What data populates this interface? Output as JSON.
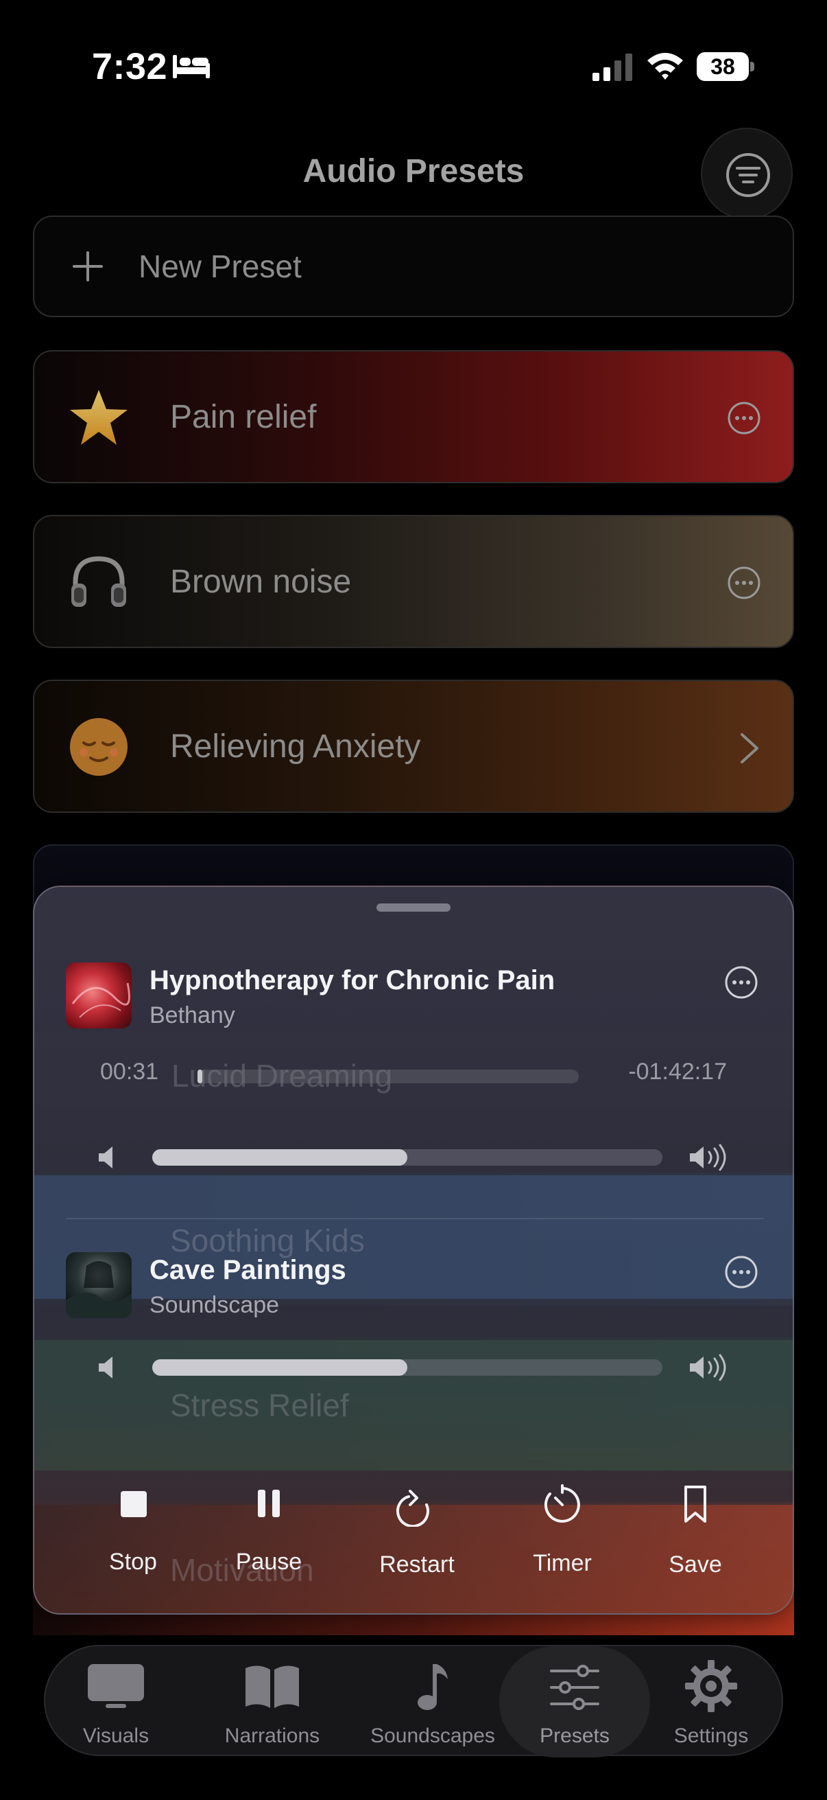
{
  "status_bar": {
    "time": "7:32",
    "battery": "38"
  },
  "header": {
    "title": "Audio Presets"
  },
  "new_preset": {
    "label": "New Preset"
  },
  "presets": [
    {
      "label": "Pain relief",
      "icon": "star-icon",
      "action": "more"
    },
    {
      "label": "Brown noise",
      "icon": "headphones-icon",
      "action": "more"
    },
    {
      "label": "Relieving Anxiety",
      "icon": "relieved-face-icon",
      "action": "chevron"
    }
  ],
  "background_presets": [
    "Lucid Dreaming",
    "Soothing Kids",
    "Stress Relief",
    "Motivation"
  ],
  "player": {
    "narration": {
      "title": "Hypnotherapy for Chronic Pain",
      "subtitle": "Bethany",
      "elapsed": "00:31",
      "remaining": "-01:42:17",
      "progress": 0.01,
      "volume": 0.5
    },
    "soundscape": {
      "title": "Cave Paintings",
      "subtitle": "Soundscape",
      "volume": 0.5
    },
    "controls": {
      "stop": "Stop",
      "pause": "Pause",
      "restart": "Restart",
      "timer": "Timer",
      "save": "Save"
    }
  },
  "tabs": [
    {
      "label": "Visuals",
      "icon": "monitor-icon"
    },
    {
      "label": "Narrations",
      "icon": "book-icon"
    },
    {
      "label": "Soundscapes",
      "icon": "music-note-icon"
    },
    {
      "label": "Presets",
      "icon": "sliders-icon",
      "active": true
    },
    {
      "label": "Settings",
      "icon": "gear-icon"
    }
  ],
  "colors": {
    "pain_relief": "#8e1d1d",
    "brown_noise": "#564835",
    "relieving_anxiety": "#5a3015",
    "accent_star": "#f5b93a"
  }
}
